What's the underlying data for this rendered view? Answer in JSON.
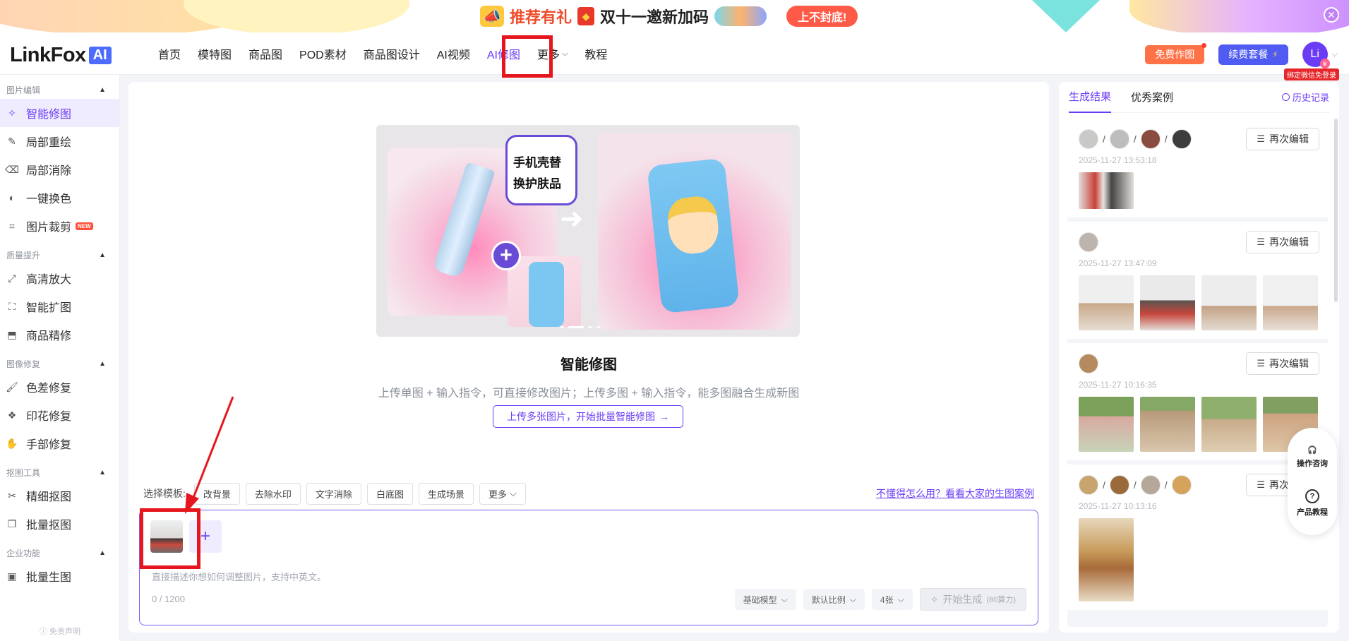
{
  "banner": {
    "text1": "推荐有礼",
    "text2": "双十一邀新加码",
    "cta": "上不封底!",
    "close": "✕"
  },
  "logo": {
    "word": "LinkFox",
    "ai": "AI"
  },
  "nav": {
    "items": [
      "首页",
      "模特图",
      "商品图",
      "POD素材",
      "商品图设计",
      "AI视频",
      "AI修图",
      "更多",
      "教程"
    ],
    "free_btn": "免费作图",
    "pkg_btn": "续费套餐",
    "avatar": "Li",
    "wx_tag": "绑定微信免登录"
  },
  "sidebar": {
    "sections": [
      {
        "title": "图片编辑",
        "items": [
          "智能修图",
          "局部重绘",
          "局部消除",
          "一键换色",
          "图片裁剪"
        ]
      },
      {
        "title": "质量提升",
        "items": [
          "高清放大",
          "智能扩图",
          "商品精修"
        ]
      },
      {
        "title": "图像修复",
        "items": [
          "色差修复",
          "印花修复",
          "手部修复"
        ]
      },
      {
        "title": "抠图工具",
        "items": [
          "精细抠图",
          "批量抠图"
        ]
      },
      {
        "title": "企业功能",
        "items": [
          "批量生图"
        ]
      }
    ],
    "new_badge": "NEW",
    "disclaimer": "免责声明"
  },
  "hero": {
    "bubble": "手机壳替换护肤品"
  },
  "main": {
    "title": "智能修图",
    "desc": "上传单图 + 输入指令，可直接修改图片；上传多图 + 输入指令，能多图融合生成新图",
    "batch_btn": "上传多张图片，开始批量智能修图",
    "template_label": "选择模板:",
    "templates": [
      "改背景",
      "去除水印",
      "文字消除",
      "白底图",
      "生成场景",
      "更多"
    ],
    "help_link": "不懂得怎么用？看看大家的生图案例",
    "placeholder": "直接描述你想如何调整图片，支持中英文。",
    "counter": "0 / 1200",
    "model": "基础模型",
    "ratio": "默认比例",
    "count": "4张",
    "generate": "开始生成",
    "generate_cost": "(80算力)"
  },
  "right": {
    "tabs": [
      "生成结果",
      "优秀案例"
    ],
    "history": "历史记录",
    "reedit": "再次编辑",
    "records": [
      {
        "time": "2025-11-27 13:53:18"
      },
      {
        "time": "2025-11-27 13:47:09"
      },
      {
        "time": "2025-11-27 10:16:35"
      },
      {
        "time": "2025-11-27 10:13:16"
      }
    ]
  },
  "float": {
    "consult": "操作咨询",
    "tutorial": "产品教程"
  }
}
